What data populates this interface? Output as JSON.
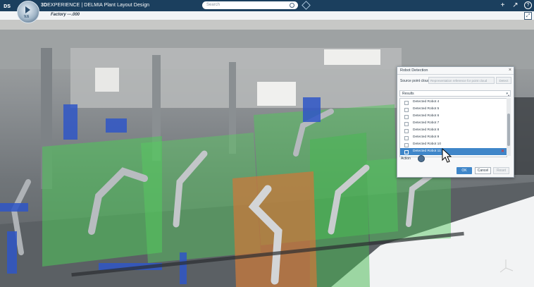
{
  "app": {
    "compass_version": "V.6",
    "brand_prefix": "3D",
    "brand_main": "EXPERIENCE | DELMIA",
    "brand_app": "Plant Layout Design",
    "search_placeholder": "Search",
    "document_title": "Factory ---.000"
  },
  "dialog": {
    "title": "Robot Detection",
    "source_label": "Source point cloud",
    "source_placeholder": "Representation reference for point cloud",
    "detect_label": "Detect",
    "results_label": "Results",
    "results": [
      "Detected Robot 4",
      "Detected Robot 5",
      "Detected Robot 6",
      "Detected Robot 7",
      "Detected Robot 8",
      "Detected Robot 9",
      "Detected Robot 10",
      "Detected Robot 11"
    ],
    "selected_index": 7,
    "action_label": "Action",
    "ok_label": "OK",
    "cancel_label": "Cancel",
    "reset_label": "Reset"
  },
  "colors": {
    "topbar": "#1b3f5e",
    "selection": "#3f86c9",
    "green_zone": "#4fc85a",
    "orange_zone": "#c87a3c",
    "robot_blue": "#2f56c7"
  }
}
